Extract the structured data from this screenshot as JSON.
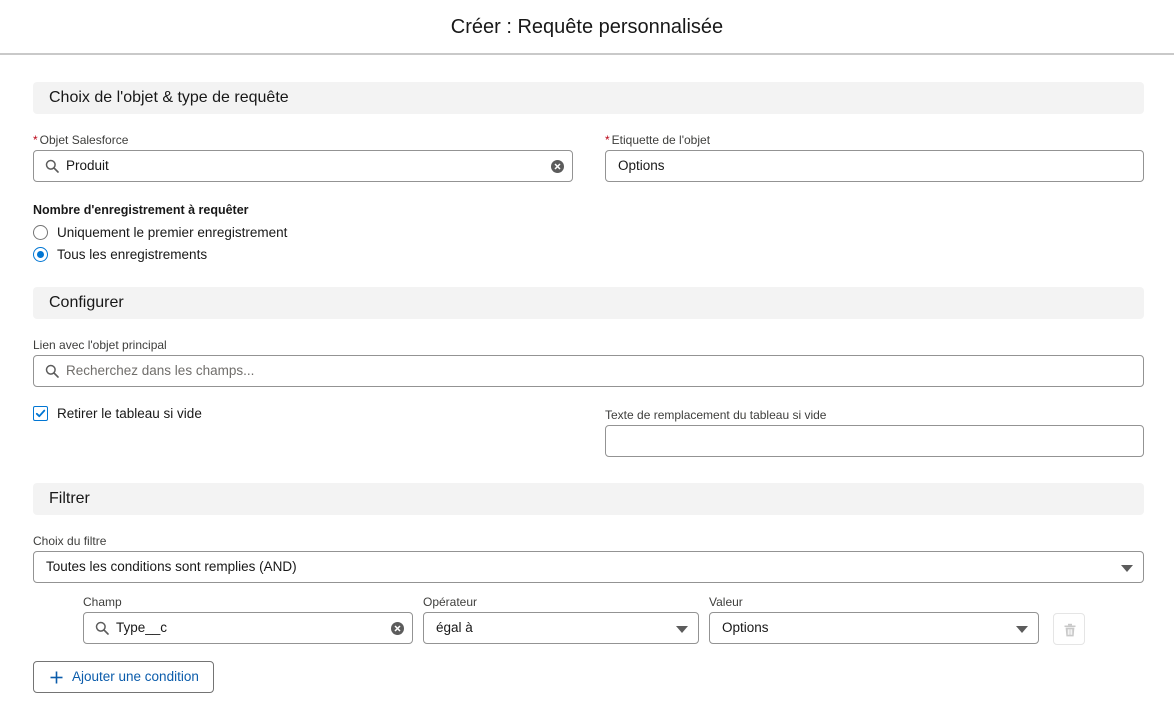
{
  "header": {
    "title": "Créer : Requête personnalisée"
  },
  "section_object": {
    "title": "Choix de l'objet & type de requête",
    "object_label": "Objet Salesforce",
    "object_value": "Produit",
    "object_label_name": "Etiquette de l'objet",
    "object_label_value": "Options",
    "record_count_label": "Nombre d'enregistrement à requêter",
    "record_options": [
      {
        "label": "Uniquement le premier enregistrement",
        "selected": false
      },
      {
        "label": "Tous les enregistrements",
        "selected": true
      }
    ]
  },
  "section_configure": {
    "title": "Configurer",
    "link_label": "Lien avec l'objet principal",
    "link_placeholder": "Recherchez dans les champs...",
    "remove_if_empty_label": "Retirer le tableau si vide",
    "remove_if_empty_checked": true,
    "replacement_text_label": "Texte de remplacement du tableau si vide",
    "replacement_text_value": ""
  },
  "section_filter": {
    "title": "Filtrer",
    "filter_choice_label": "Choix du filtre",
    "filter_choice_value": "Toutes les conditions sont remplies (AND)",
    "condition": {
      "field_label": "Champ",
      "field_value": "Type__c",
      "operator_label": "Opérateur",
      "operator_value": "égal à",
      "value_label": "Valeur",
      "value_value": "Options"
    },
    "add_condition_label": "Ajouter une condition"
  },
  "colors": {
    "accent": "#0176d3",
    "link": "#0b5cab",
    "required": "#ba0517",
    "section_bg": "#f3f3f3",
    "border": "#939393"
  },
  "icons": [
    "search-icon",
    "clear-icon",
    "chevron-down-icon",
    "checkmark-icon",
    "trash-icon",
    "plus-icon"
  ]
}
